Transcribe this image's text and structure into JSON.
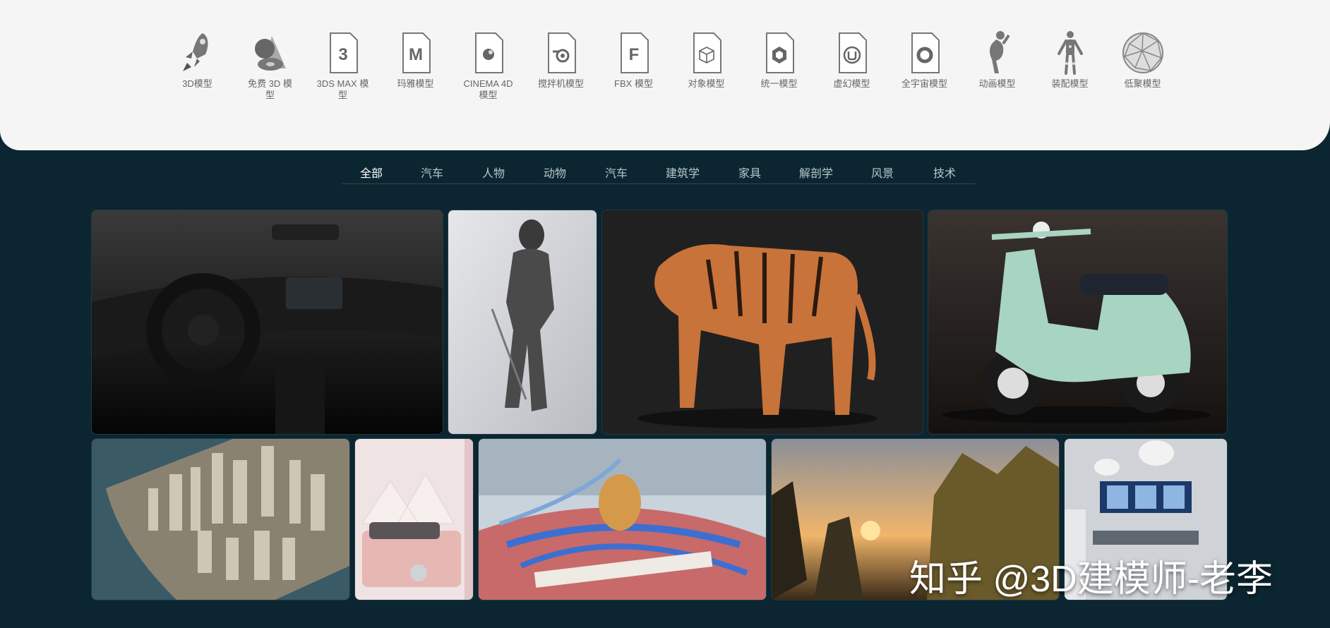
{
  "categories": [
    {
      "label": "3D模型",
      "icon": "rocket-icon"
    },
    {
      "label": "免费 3D 模型",
      "icon": "free-shapes-icon"
    },
    {
      "label": "3DS MAX 模型",
      "icon": "3ds-max-icon",
      "glyph": "3"
    },
    {
      "label": "玛雅模型",
      "icon": "maya-icon",
      "glyph": "M"
    },
    {
      "label": "CINEMA 4D 模型",
      "icon": "cinema4d-icon"
    },
    {
      "label": "搅拌机模型",
      "icon": "blender-icon"
    },
    {
      "label": "FBX 模型",
      "icon": "fbx-icon",
      "glyph": "F"
    },
    {
      "label": "对象模型",
      "icon": "obj-cube-icon"
    },
    {
      "label": "统一模型",
      "icon": "unity-icon"
    },
    {
      "label": "虚幻模型",
      "icon": "unreal-icon"
    },
    {
      "label": "全宇宙模型",
      "icon": "universe-ring-icon"
    },
    {
      "label": "动画模型",
      "icon": "animated-figure-icon"
    },
    {
      "label": "装配模型",
      "icon": "rigged-figure-icon"
    },
    {
      "label": "低聚模型",
      "icon": "low-poly-sphere-icon"
    }
  ],
  "tabs": [
    "全部",
    "汽车",
    "人物",
    "动物",
    "汽车",
    "建筑学",
    "家具",
    "解剖学",
    "风景",
    "技术"
  ],
  "active_tab": "全部",
  "gallery": [
    {
      "subject": "car-interior"
    },
    {
      "subject": "knight-armor"
    },
    {
      "subject": "tiger"
    },
    {
      "subject": "scooter"
    },
    {
      "subject": "city-aerial"
    },
    {
      "subject": "kids-bedroom"
    },
    {
      "subject": "anatomy-neck"
    },
    {
      "subject": "mountain-landscape"
    },
    {
      "subject": "operating-room"
    }
  ],
  "watermark": "知乎 @3D建模师-老李",
  "colors": {
    "background": "#0b2630",
    "panel": "#f5f5f5",
    "icon_gray": "#6e6e6e"
  }
}
